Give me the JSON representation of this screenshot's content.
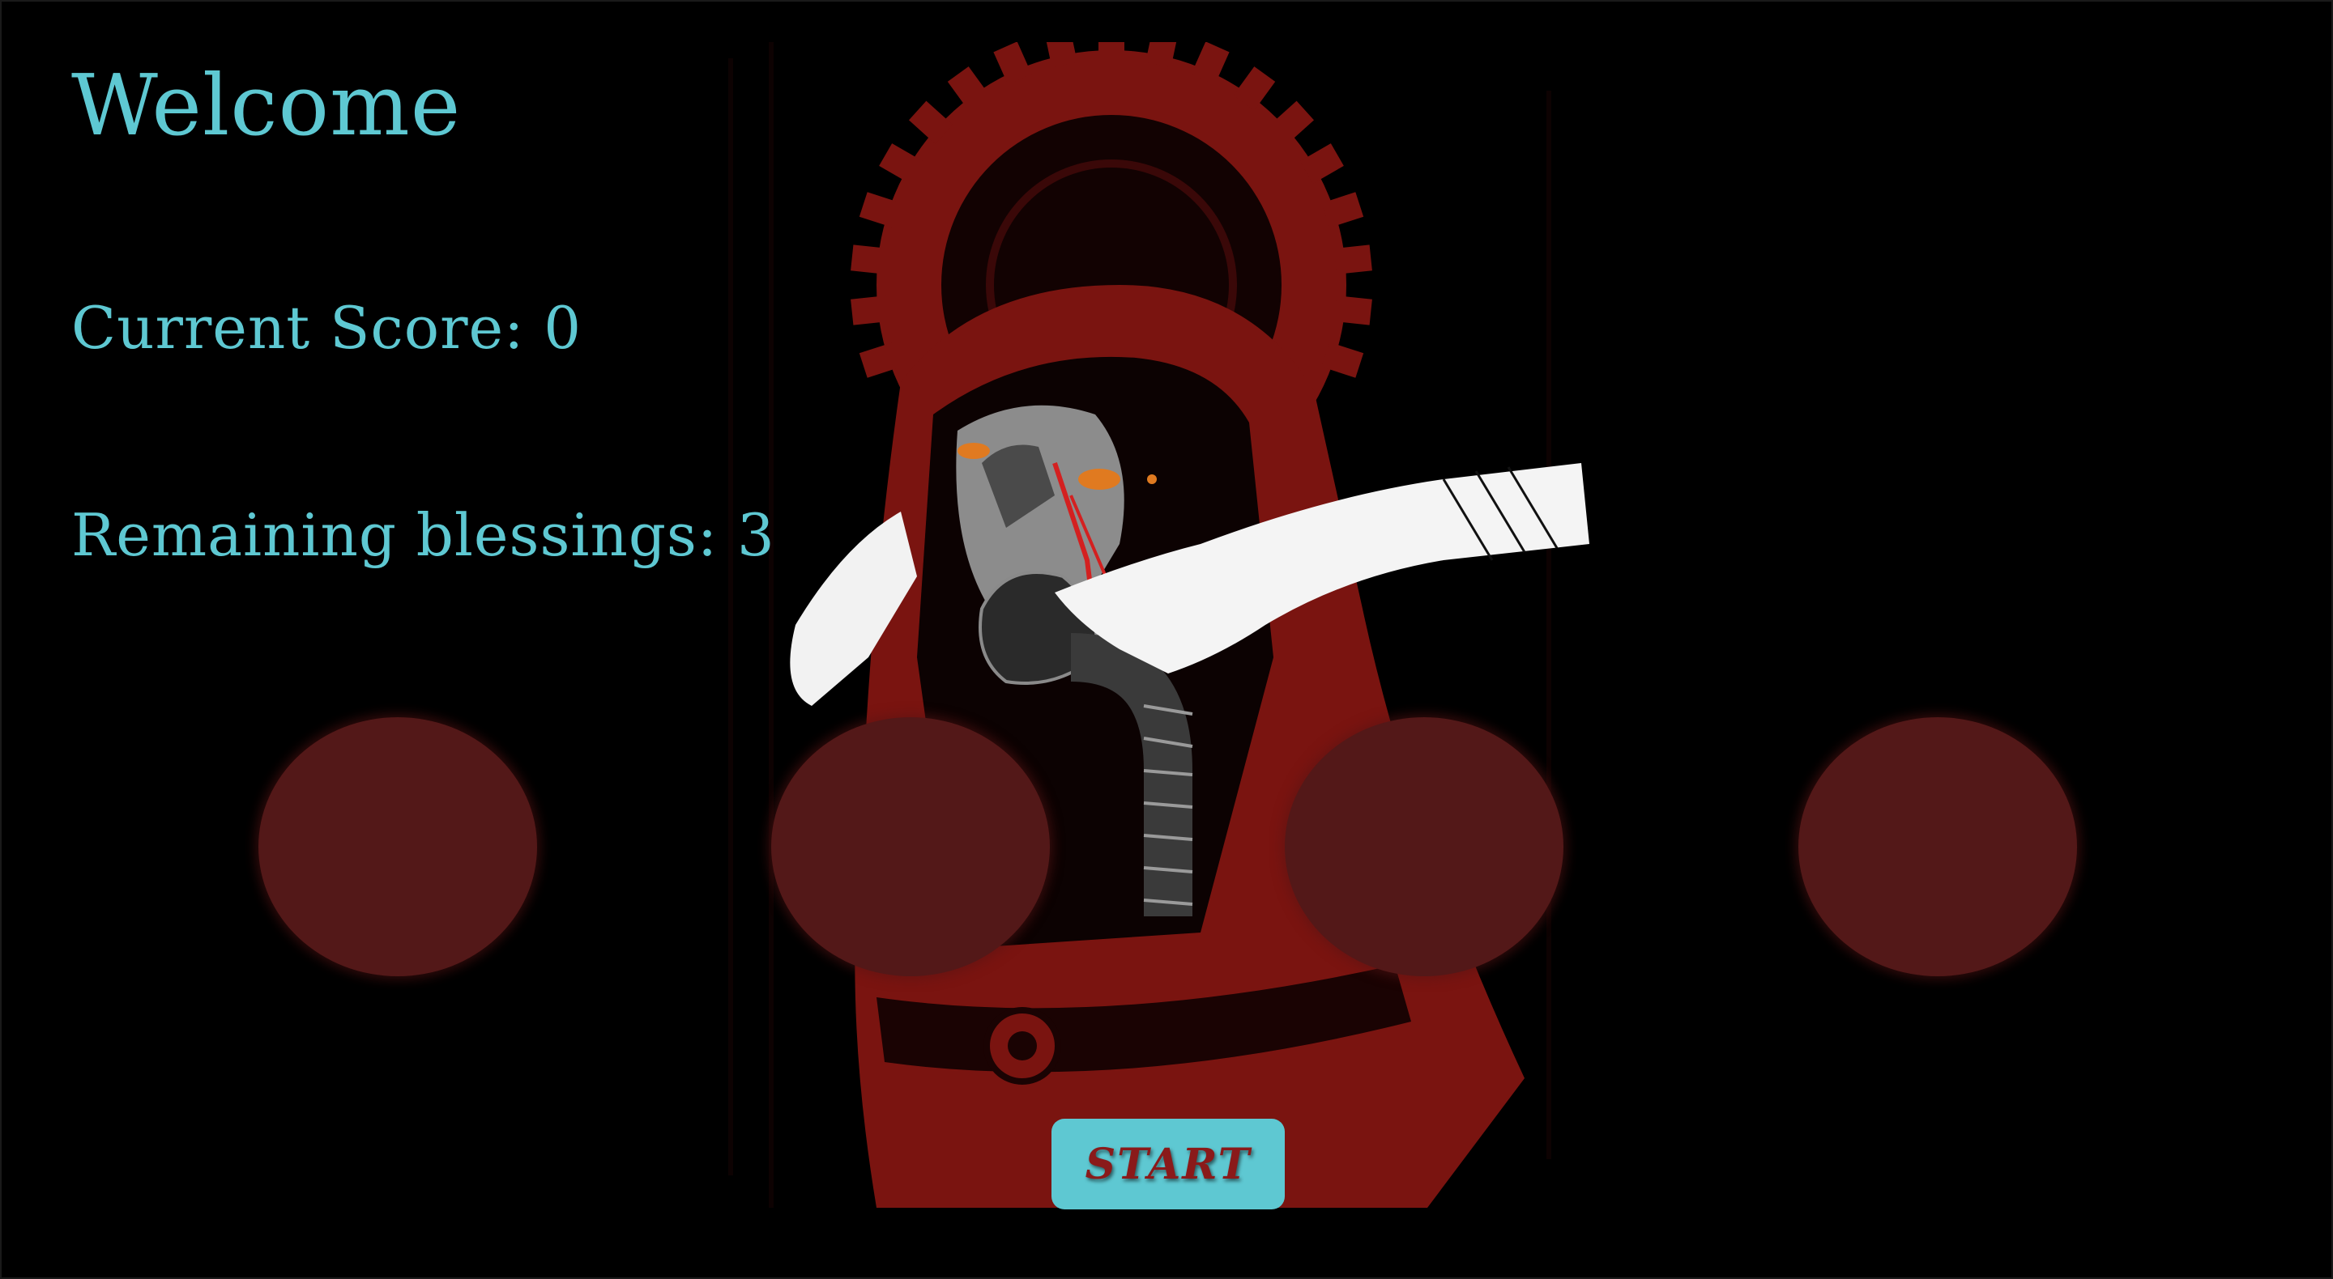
{
  "hud": {
    "title": "Welcome",
    "score_label": "Current Score: ",
    "score_value": "0",
    "blessings_label": "Remaining blessings: ",
    "blessings_value": "3"
  },
  "holes": [
    {
      "name": "hole-1"
    },
    {
      "name": "hole-2"
    },
    {
      "name": "hole-3"
    },
    {
      "name": "hole-4"
    }
  ],
  "controls": {
    "start_label": "START"
  },
  "colors": {
    "background": "#000000",
    "hud_text": "#5ec8d2",
    "hole_fill": "#531818",
    "start_button_bg": "#5ec8d2",
    "start_button_text": "#8a1a1a",
    "illustration_red": "#7a1410"
  },
  "illustration": {
    "subject": "hooded-figure-with-gas-mask-and-gear-halo"
  }
}
